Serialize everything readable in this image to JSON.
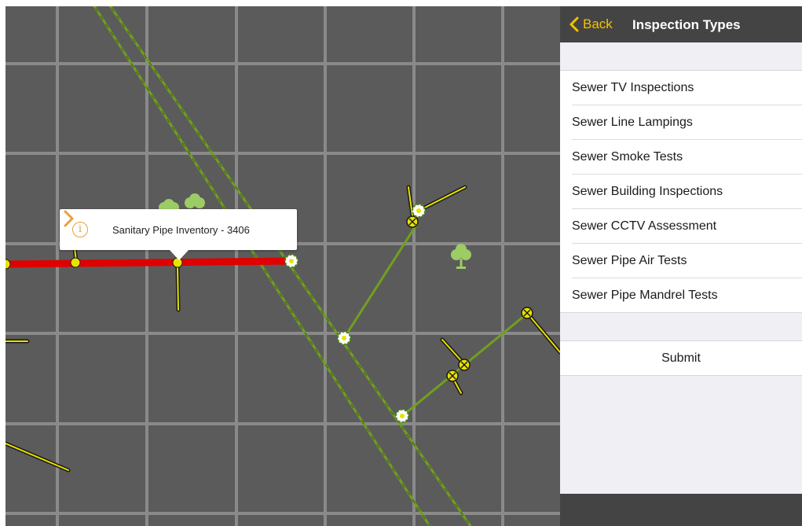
{
  "map": {
    "callout": {
      "title": "Sanitary Pipe Inventory - 3406",
      "info_icon": "info-icon",
      "chevron_icon": "chevron-right-icon"
    },
    "colors": {
      "background": "#5c5b5b",
      "grid": "#8a8a8a",
      "selected_pipe": "#e00000",
      "pipe_green": "#6fa01e",
      "lateral_yellow": "#e8e200",
      "tree_green": "#9ccc65"
    }
  },
  "panel": {
    "back_label": "Back",
    "title": "Inspection Types",
    "accent_color": "#f2c200",
    "items": [
      {
        "label": "Sewer TV Inspections"
      },
      {
        "label": "Sewer Line Lampings"
      },
      {
        "label": "Sewer Smoke Tests"
      },
      {
        "label": "Sewer Building Inspections"
      },
      {
        "label": "Sewer CCTV Assessment"
      },
      {
        "label": "Sewer Pipe Air Tests"
      },
      {
        "label": "Sewer Pipe Mandrel Tests"
      }
    ],
    "submit_label": "Submit"
  }
}
